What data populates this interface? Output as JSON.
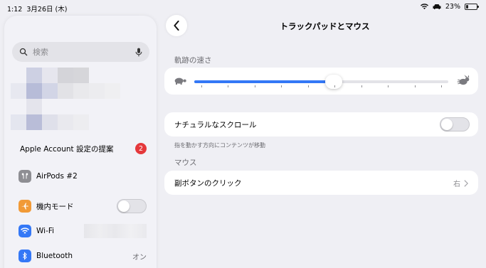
{
  "status_bar": {
    "time": "1:12",
    "date": "3月26日 (木)",
    "battery": "23%",
    "battery_level": 0.23
  },
  "sidebar": {
    "search_placeholder": "検索",
    "account_suggestion": {
      "label": "Apple Account 設定の提案",
      "badge": "2"
    },
    "items": [
      {
        "label": "AirPods #2",
        "icon": "airpods-icon",
        "color": "#8e8e93"
      },
      {
        "label": "機内モード",
        "icon": "airplane-icon",
        "color": "#f19a37",
        "toggle_on": false
      },
      {
        "label": "Wi-Fi",
        "icon": "wifi-icon",
        "color": "#3478f6"
      },
      {
        "label": "Bluetooth",
        "icon": "bluetooth-icon",
        "color": "#3478f6",
        "value": "オン"
      }
    ]
  },
  "detail": {
    "title": "トラックパッドとマウス",
    "tracking_speed": {
      "header": "軌跡の速さ",
      "value": 0.55,
      "ticks": 10
    },
    "natural_scroll": {
      "label": "ナチュラルなスクロール",
      "enabled": false,
      "footnote": "指を動かす方向にコンテンツが移動"
    },
    "mouse_section": {
      "header": "マウス",
      "secondary_click": {
        "label": "副ボタンのクリック",
        "value": "右"
      }
    }
  },
  "colors": {
    "accent": "#3478f6",
    "badge": "#e5383b",
    "background": "#efeff4"
  }
}
